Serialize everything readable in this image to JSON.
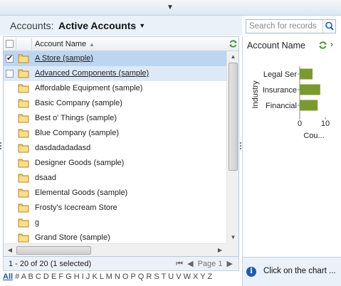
{
  "view": {
    "prefix": "Accounts:",
    "name": "Active Accounts"
  },
  "search": {
    "placeholder": "Search for records"
  },
  "grid": {
    "column_header": "Account Name",
    "rows": [
      {
        "name": "A Store (sample)",
        "checked": true,
        "state": "selected"
      },
      {
        "name": "Advanced Components (sample)",
        "checked": false,
        "state": "highlighted"
      },
      {
        "name": "Affordable Equipment (sample)",
        "checked": false,
        "state": ""
      },
      {
        "name": "Basic Company (sample)",
        "checked": false,
        "state": ""
      },
      {
        "name": "Best o' Things (sample)",
        "checked": false,
        "state": ""
      },
      {
        "name": "Blue Company (sample)",
        "checked": false,
        "state": ""
      },
      {
        "name": "dasdadadadasd",
        "checked": false,
        "state": ""
      },
      {
        "name": "Designer Goods (sample)",
        "checked": false,
        "state": ""
      },
      {
        "name": "dsaad",
        "checked": false,
        "state": ""
      },
      {
        "name": "Elemental Goods (sample)",
        "checked": false,
        "state": ""
      },
      {
        "name": "Frosty's Icecream Store",
        "checked": false,
        "state": ""
      },
      {
        "name": "g",
        "checked": false,
        "state": ""
      },
      {
        "name": "Grand Store (sample)",
        "checked": false,
        "state": ""
      }
    ]
  },
  "footer": {
    "record_count": "1 - 20 of 20 (1 selected)",
    "page_label": "Page 1"
  },
  "alpha_filter": [
    "All",
    "#",
    "A",
    "B",
    "C",
    "D",
    "E",
    "F",
    "G",
    "H",
    "I",
    "J",
    "K",
    "L",
    "M",
    "N",
    "O",
    "P",
    "Q",
    "R",
    "S",
    "T",
    "U",
    "V",
    "W",
    "X",
    "Y",
    "Z"
  ],
  "chart_pane": {
    "title": "Account Name",
    "info_text": "Click on the chart ..."
  },
  "chart_data": {
    "type": "bar",
    "orientation": "horizontal",
    "categories": [
      "Legal Ser",
      "Insurance",
      "Financial"
    ],
    "values": [
      5,
      8,
      7
    ],
    "ylabel": "Industry",
    "xlabel": "Cou...",
    "xticks": [
      "0",
      "10"
    ],
    "xlim": [
      0,
      10
    ],
    "bar_color": "#7a9a2e"
  },
  "colors": {
    "accent": "#1a55a3",
    "selected_row": "#bcd6f0",
    "hover_row": "#dde9f6"
  }
}
